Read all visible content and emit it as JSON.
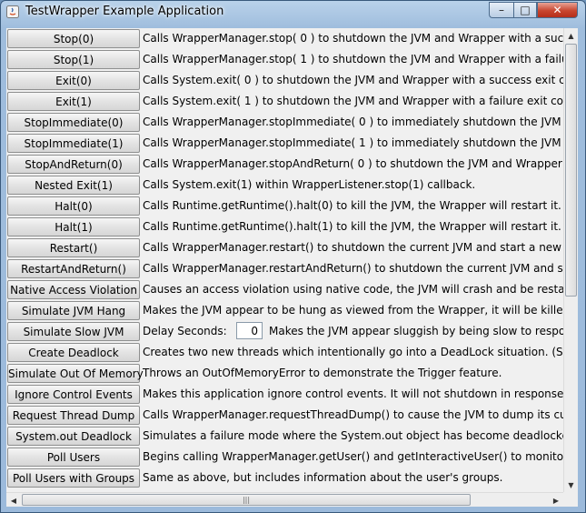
{
  "window": {
    "title": "TestWrapper Example Application",
    "minimize": "–",
    "maximize": "□",
    "close": "✕"
  },
  "rows": [
    {
      "button": "Stop(0)",
      "description": "Calls WrapperManager.stop( 0 ) to shutdown the JVM and Wrapper with a success ex"
    },
    {
      "button": "Stop(1)",
      "description": "Calls WrapperManager.stop( 1 ) to shutdown the JVM and Wrapper with a failure exit c"
    },
    {
      "button": "Exit(0)",
      "description": "Calls System.exit( 0 ) to shutdown the JVM and Wrapper with a success exit code."
    },
    {
      "button": "Exit(1)",
      "description": "Calls System.exit( 1 ) to shutdown the JVM and Wrapper with a failure exit code."
    },
    {
      "button": "StopImmediate(0)",
      "description": "Calls WrapperManager.stopImmediate( 0 ) to immediately shutdown the JVM and Wra"
    },
    {
      "button": "StopImmediate(1)",
      "description": " Calls WrapperManager.stopImmediate( 1 ) to immediately shutdown the JVM and Wr"
    },
    {
      "button": "StopAndReturn(0)",
      "description": "Calls WrapperManager.stopAndReturn( 0 ) to shutdown the JVM and Wrapper with a s"
    },
    {
      "button": "Nested Exit(1)",
      "description": "Calls System.exit(1) within WrapperListener.stop(1) callback."
    },
    {
      "button": "Halt(0)",
      "description": "Calls Runtime.getRuntime().halt(0) to kill the JVM, the Wrapper will restart it."
    },
    {
      "button": "Halt(1)",
      "description": "Calls Runtime.getRuntime().halt(1) to kill the JVM, the Wrapper will restart it."
    },
    {
      "button": "Restart()",
      "description": "Calls WrapperManager.restart() to shutdown the current JVM and start a new one."
    },
    {
      "button": "RestartAndReturn()",
      "description": "Calls WrapperManager.restartAndReturn() to shutdown the current JVM and start a ne"
    },
    {
      "button": "Native Access Violation",
      "description": "Causes an access violation using native code, the JVM will crash and be restarted."
    },
    {
      "button": "Simulate JVM Hang",
      "description": "Makes the JVM appear to be hung as viewed from the Wrapper, it will be killed and res"
    },
    {
      "button": "Simulate Slow JVM",
      "description": ""
    },
    {
      "button": "Create Deadlock",
      "description": "Creates two new threads which intentionally go into a DeadLock situation.  (Standard"
    },
    {
      "button": "Simulate Out Of Memory",
      "description": "Throws an OutOfMemoryError to demonstrate the Trigger feature."
    },
    {
      "button": "Ignore Control Events",
      "description": "Makes this application ignore control events.  It will not shutdown in response to CTR"
    },
    {
      "button": "Request Thread Dump",
      "description": "Calls WrapperManager.requestThreadDump() to cause the JVM to dump its current th"
    },
    {
      "button": "System.out Deadlock",
      "description": "Simulates a failure mode where the System.out object has become deadlocked."
    },
    {
      "button": "Poll Users",
      "description": "Begins calling WrapperManager.getUser() and getInteractiveUser() to monitor the cur"
    },
    {
      "button": "Poll Users with Groups",
      "description": "Same as above, but includes information about the user's groups."
    }
  ],
  "slow_jvm": {
    "label": "Delay Seconds:",
    "value": "0",
    "description": "Makes the JVM appear sluggish by being slow to respond to"
  },
  "scrollbars": {
    "up": "▲",
    "down": "▼",
    "left": "◀",
    "right": "▶",
    "grip": "|||"
  }
}
